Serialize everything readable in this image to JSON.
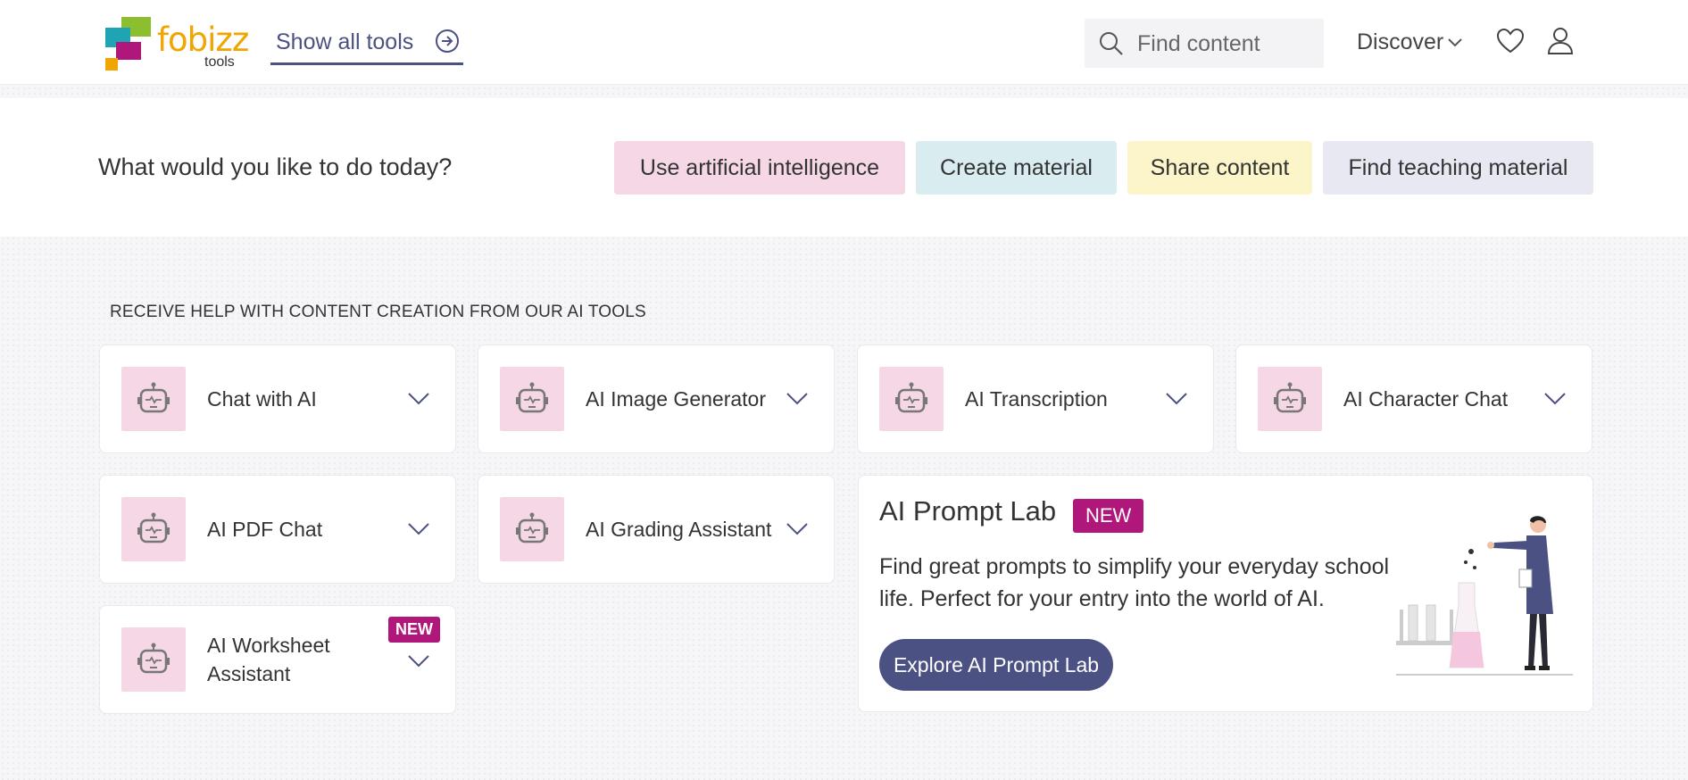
{
  "header": {
    "logo_word": "fobizz",
    "logo_sub": "tools",
    "show_all_label": "Show all tools",
    "search_placeholder": "Find content",
    "discover_label": "Discover"
  },
  "banner": {
    "question": "What would you like to do today?",
    "pills": [
      {
        "label": "Use artificial intelligence",
        "color": "#f5d7e6"
      },
      {
        "label": "Create material",
        "color": "#d9ecf0"
      },
      {
        "label": "Share content",
        "color": "#fbf5c9"
      },
      {
        "label": "Find teaching material",
        "color": "#e7e8f2"
      }
    ]
  },
  "section_title": "RECEIVE HELP WITH CONTENT CREATION FROM OUR AI TOOLS",
  "tools": [
    {
      "label": "Chat with AI",
      "icon": "robot-icon"
    },
    {
      "label": "AI Image Generator",
      "icon": "robot-icon"
    },
    {
      "label": "AI Transcription",
      "icon": "robot-icon"
    },
    {
      "label": "AI Character Chat",
      "icon": "robot-icon"
    },
    {
      "label": "AI PDF Chat",
      "icon": "robot-icon"
    },
    {
      "label": "AI Grading Assistant",
      "icon": "robot-icon"
    },
    {
      "label": "AI Worksheet Assistant",
      "icon": "robot-icon",
      "badge": "NEW"
    }
  ],
  "prompt_lab": {
    "title": "AI Prompt Lab",
    "badge": "NEW",
    "description": "Find great prompts to simplify your everyday school life. Perfect for your entry into the world of AI.",
    "button_label": "Explore AI Prompt Lab"
  },
  "colors": {
    "accent": "#4b5182",
    "badge": "#b0177a",
    "tool_icon_bg": "#f5d7e6"
  }
}
